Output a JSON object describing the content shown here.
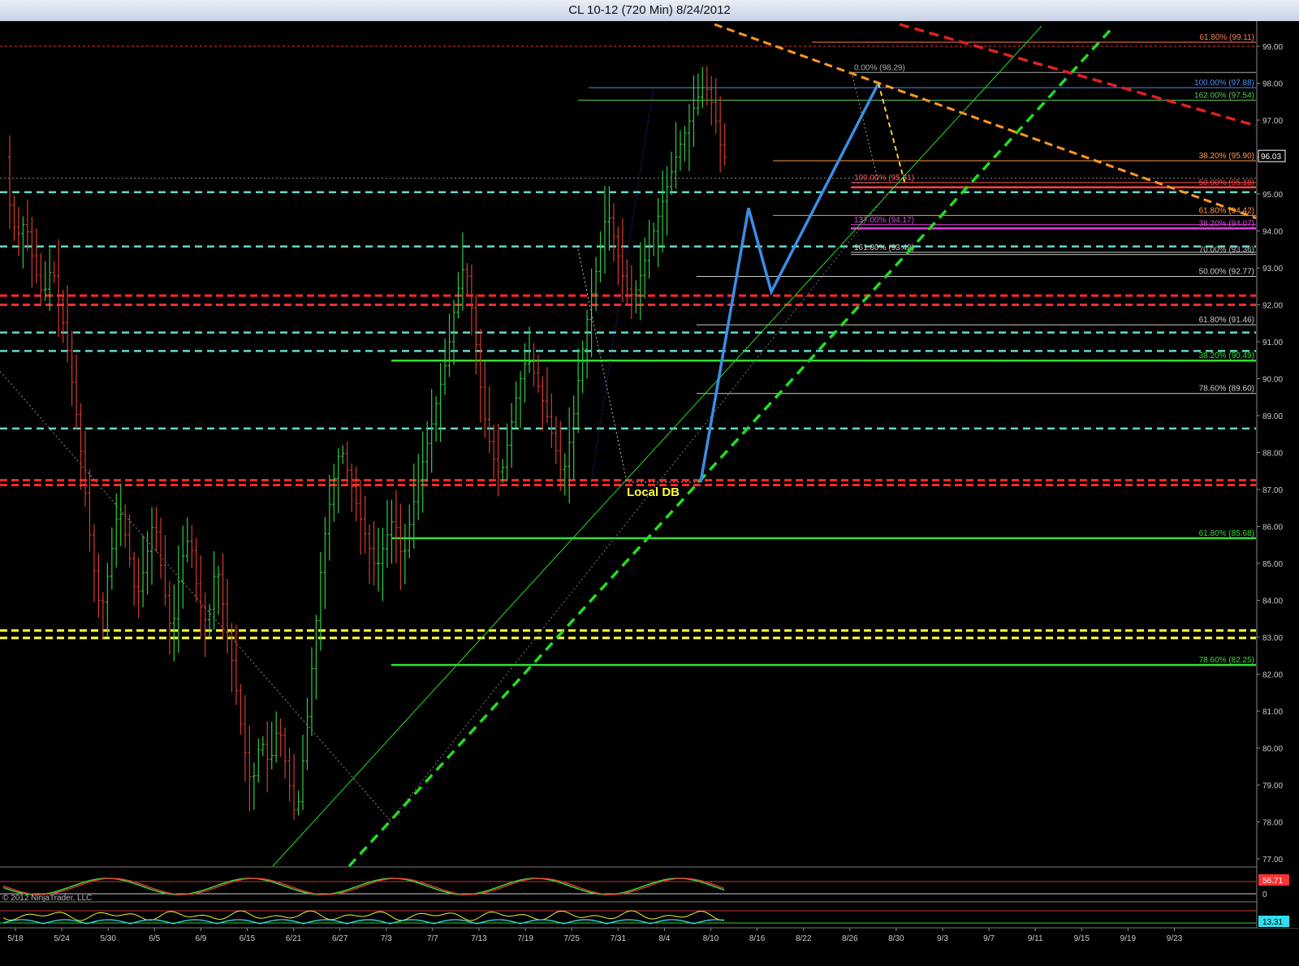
{
  "window": {
    "title": "CL 10-12 (720 Min)  8/24/2012"
  },
  "copyright": "© 2012 NinjaTrader, LLC",
  "colors": {
    "background": "#000000",
    "up_bar": "#2ecc40",
    "down_bar": "#d43c2c",
    "red_level": "#ff2a2a",
    "cyan_level": "#66d9c8",
    "yellow_level": "#ffff33",
    "green_level": "#33dd33",
    "pattern_blue": "#3a8ee6",
    "trend_green": "#22dd22",
    "trend_orange": "#ff9922",
    "trend_red": "#e02020"
  },
  "annotations": {
    "local_db": "Local DB"
  },
  "chart_data": [
    {
      "type": "candlestick",
      "title": "CL 10-12 (720 Min)  8/24/2012",
      "ylim": [
        76.5,
        99.5
      ],
      "y_ticks": [
        "77.00",
        "78.00",
        "79.00",
        "80.00",
        "81.00",
        "82.00",
        "83.00",
        "84.00",
        "85.00",
        "86.00",
        "87.00",
        "88.00",
        "89.00",
        "90.00",
        "91.00",
        "92.00",
        "93.00",
        "94.00",
        "95.00",
        "96.00",
        "97.00",
        "98.00",
        "99.00"
      ],
      "x_ticks": [
        "5/18",
        "5/24",
        "5/30",
        "6/5",
        "6/9",
        "6/15",
        "6/21",
        "6/27",
        "7/3",
        "7/7",
        "7/13",
        "7/19",
        "7/25",
        "7/31",
        "8/4",
        "8/10",
        "8/16",
        "8/22",
        "8/26",
        "8/30",
        "9/3",
        "9/7",
        "9/11",
        "9/15",
        "9/19",
        "9/23"
      ],
      "last_price": "96.03",
      "price_path": [
        [
          0,
          95.0
        ],
        [
          2,
          93.8
        ],
        [
          4,
          94.3
        ],
        [
          6,
          93.0
        ],
        [
          8,
          92.2
        ],
        [
          10,
          93.1
        ],
        [
          13,
          91.2
        ],
        [
          16,
          88.6
        ],
        [
          19,
          85.2
        ],
        [
          21,
          83.6
        ],
        [
          23,
          85.0
        ],
        [
          25,
          86.6
        ],
        [
          27,
          85.5
        ],
        [
          29,
          84.0
        ],
        [
          31,
          85.0
        ],
        [
          33,
          86.3
        ],
        [
          35,
          84.5
        ],
        [
          37,
          83.0
        ],
        [
          39,
          85.0
        ],
        [
          41,
          85.8
        ],
        [
          43,
          84.0
        ],
        [
          45,
          83.3
        ],
        [
          47,
          85.1
        ],
        [
          49,
          83.5
        ],
        [
          51,
          82.0
        ],
        [
          53,
          80.2
        ],
        [
          55,
          78.9
        ],
        [
          57,
          80.3
        ],
        [
          59,
          79.5
        ],
        [
          61,
          80.7
        ],
        [
          63,
          79.3
        ],
        [
          65,
          78.0
        ],
        [
          67,
          80.2
        ],
        [
          69,
          82.8
        ],
        [
          71,
          85.4
        ],
        [
          73,
          87.0
        ],
        [
          75,
          88.2
        ],
        [
          77,
          87.3
        ],
        [
          79,
          86.4
        ],
        [
          81,
          85.6
        ],
        [
          83,
          84.8
        ],
        [
          85,
          85.6
        ],
        [
          87,
          86.3
        ],
        [
          89,
          85.0
        ],
        [
          91,
          86.4
        ],
        [
          93,
          87.5
        ],
        [
          95,
          88.5
        ],
        [
          97,
          89.6
        ],
        [
          99,
          90.6
        ],
        [
          101,
          92.2
        ],
        [
          103,
          93.2
        ],
        [
          105,
          91.5
        ],
        [
          107,
          89.2
        ],
        [
          109,
          88.0
        ],
        [
          111,
          87.3
        ],
        [
          113,
          88.5
        ],
        [
          115,
          89.8
        ],
        [
          117,
          90.6
        ],
        [
          119,
          90.0
        ],
        [
          121,
          89.2
        ],
        [
          123,
          88.3
        ],
        [
          125,
          87.3
        ],
        [
          127,
          88.6
        ],
        [
          129,
          90.4
        ],
        [
          131,
          92.0
        ],
        [
          133,
          93.2
        ],
        [
          135,
          94.6
        ],
        [
          137,
          93.6
        ],
        [
          139,
          92.5
        ],
        [
          141,
          92.2
        ],
        [
          143,
          93.0
        ],
        [
          145,
          93.8
        ],
        [
          147,
          94.6
        ],
        [
          149,
          95.4
        ],
        [
          151,
          96.2
        ],
        [
          153,
          96.8
        ],
        [
          155,
          97.5
        ],
        [
          157,
          98.0
        ],
        [
          159,
          97.3
        ],
        [
          161,
          96.0
        ]
      ],
      "horizontal_levels": [
        {
          "price": 99.0,
          "style": "red-dotted"
        },
        {
          "price": 95.43,
          "style": "gray-dotted"
        },
        {
          "price": 95.05,
          "style": "cyan-dash"
        },
        {
          "price": 93.58,
          "style": "cyan-dash"
        },
        {
          "price": 92.25,
          "style": "red-dash"
        },
        {
          "price": 92.0,
          "style": "red-dash"
        },
        {
          "price": 91.25,
          "style": "cyan-dash"
        },
        {
          "price": 90.75,
          "style": "cyan-dash"
        },
        {
          "price": 88.65,
          "style": "cyan-dash"
        },
        {
          "price": 87.25,
          "style": "red-dash"
        },
        {
          "price": 87.12,
          "style": "red-dash"
        },
        {
          "price": 83.18,
          "style": "yellow-dash"
        },
        {
          "price": 82.98,
          "style": "yellow-dash"
        }
      ],
      "fib_levels": [
        {
          "label": "61.80% (99.11)",
          "price": 99.11,
          "x_start": 1000,
          "color": "#ff7a5a",
          "bold": false
        },
        {
          "label": "0.00% (98.29)",
          "price": 98.29,
          "x_start": 1048,
          "color": "#aaaaaa",
          "bold": false,
          "label_left": true
        },
        {
          "label": "100.00% (97.88)",
          "price": 97.88,
          "x_start": 725,
          "color": "#4a8ef0",
          "bold": false
        },
        {
          "label": "162.00% (97.54)",
          "price": 97.54,
          "x_start": 712,
          "color": "#55cc55",
          "bold": false
        },
        {
          "label": "38.20% (95.90)",
          "price": 95.9,
          "x_start": 952,
          "color": "#ff9944",
          "bold": false
        },
        {
          "label": "50.00% (95.18)",
          "price": 95.18,
          "x_start": 1048,
          "color": "#ff4444",
          "bold": true
        },
        {
          "label": "100.00% (95.31)",
          "price": 95.31,
          "x_start": 1048,
          "color": "#ff5555",
          "bold": false,
          "label_left": true
        },
        {
          "label": "61.80% (94.42)",
          "price": 94.42,
          "x_start": 952,
          "color": "#ff9944",
          "bold": false
        },
        {
          "label": "38.20% (94.07)",
          "price": 94.07,
          "x_start": 1048,
          "color": "#dd44dd",
          "bold": true
        },
        {
          "label": "137.00% (94.17)",
          "price": 94.17,
          "x_start": 1048,
          "color": "#dd44dd",
          "bold": false,
          "label_left": true
        },
        {
          "label": "161.80% (93.42)",
          "price": 93.42,
          "x_start": 1048,
          "color": "#cccccc",
          "bold": false,
          "label_left": true
        },
        {
          "label": "70.00% (93.36)",
          "price": 93.36,
          "x_start": 1048,
          "color": "#bbbbbb",
          "bold": false
        },
        {
          "label": "50.00% (92.77)",
          "price": 92.77,
          "x_start": 858,
          "color": "#cccccc",
          "bold": false
        },
        {
          "label": "61.80% (91.46)",
          "price": 91.46,
          "x_start": 858,
          "color": "#cccccc",
          "bold": false
        },
        {
          "label": "38.20% (90.49)",
          "price": 90.49,
          "x_start": 482,
          "color": "#33dd33",
          "bold": true
        },
        {
          "label": "78.60% (89.60)",
          "price": 89.6,
          "x_start": 858,
          "color": "#cccccc",
          "bold": false
        },
        {
          "label": "61.80% (85.68)",
          "price": 85.68,
          "x_start": 482,
          "color": "#33dd33",
          "bold": true
        },
        {
          "label": "78.60% (82.25)",
          "price": 82.25,
          "x_start": 482,
          "color": "#33dd33",
          "bold": true
        }
      ],
      "indicator_panels": [
        {
          "last_value": "56.71",
          "ticks": [
            "0"
          ],
          "badge_color": "#ff3333"
        },
        {
          "last_value": "13.31",
          "ticks": [],
          "badge_color": "#33ddee"
        }
      ]
    }
  ]
}
